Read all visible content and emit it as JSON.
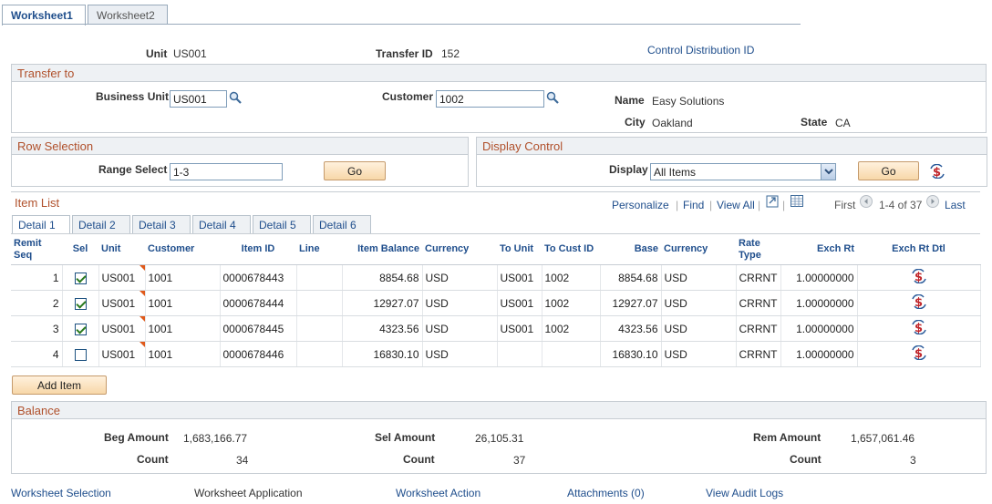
{
  "page_tabs": [
    "Worksheet1",
    "Worksheet2"
  ],
  "header": {
    "unit_label": "Unit",
    "unit_value": "US001",
    "transfer_id_label": "Transfer ID",
    "transfer_id_value": "152",
    "control_dist_link": "Control Distribution ID"
  },
  "transfer_to": {
    "title": "Transfer to",
    "business_unit_label": "Business Unit",
    "business_unit_value": "US001",
    "customer_label": "Customer",
    "customer_value": "1002",
    "name_label": "Name",
    "name_value": "Easy Solutions",
    "city_label": "City",
    "city_value": "Oakland",
    "state_label": "State",
    "state_value": "CA"
  },
  "row_selection": {
    "title": "Row Selection",
    "range_label": "Range Select",
    "range_value": "1-3",
    "go_label": "Go"
  },
  "display_control": {
    "title": "Display Control",
    "display_label": "Display",
    "display_value": "All Items",
    "go_label": "Go"
  },
  "item_list": {
    "title": "Item List",
    "personalize": "Personalize",
    "find": "Find",
    "view_all": "View All",
    "first": "First",
    "range": "1-4 of 37",
    "last": "Last",
    "tabs": [
      "Detail 1",
      "Detail 2",
      "Detail 3",
      "Detail 4",
      "Detail 5",
      "Detail 6"
    ],
    "columns": {
      "remit_seq": "Remit Seq",
      "sel": "Sel",
      "unit": "Unit",
      "customer": "Customer",
      "item_id": "Item ID",
      "line": "Line",
      "item_balance": "Item Balance",
      "currency": "Currency",
      "to_unit": "To Unit",
      "to_cust_id": "To Cust ID",
      "base": "Base",
      "base_currency": "Currency",
      "rate_type": "Rate Type",
      "exch_rt": "Exch Rt",
      "exch_rt_dtl": "Exch Rt Dtl"
    },
    "rows": [
      {
        "seq": "1",
        "sel": true,
        "unit": "US001",
        "customer": "1001",
        "item_id": "0000678443",
        "line": "",
        "balance": "8854.68",
        "currency": "USD",
        "to_unit": "US001",
        "to_cust": "1002",
        "base": "8854.68",
        "base_currency": "USD",
        "rate_type": "CRRNT",
        "exch_rt": "1.00000000"
      },
      {
        "seq": "2",
        "sel": true,
        "unit": "US001",
        "customer": "1001",
        "item_id": "0000678444",
        "line": "",
        "balance": "12927.07",
        "currency": "USD",
        "to_unit": "US001",
        "to_cust": "1002",
        "base": "12927.07",
        "base_currency": "USD",
        "rate_type": "CRRNT",
        "exch_rt": "1.00000000"
      },
      {
        "seq": "3",
        "sel": true,
        "unit": "US001",
        "customer": "1001",
        "item_id": "0000678445",
        "line": "",
        "balance": "4323.56",
        "currency": "USD",
        "to_unit": "US001",
        "to_cust": "1002",
        "base": "4323.56",
        "base_currency": "USD",
        "rate_type": "CRRNT",
        "exch_rt": "1.00000000"
      },
      {
        "seq": "4",
        "sel": false,
        "unit": "US001",
        "customer": "1001",
        "item_id": "0000678446",
        "line": "",
        "balance": "16830.10",
        "currency": "USD",
        "to_unit": "",
        "to_cust": "",
        "base": "16830.10",
        "base_currency": "USD",
        "rate_type": "CRRNT",
        "exch_rt": "1.00000000"
      }
    ],
    "add_item_label": "Add Item"
  },
  "balance": {
    "title": "Balance",
    "beg_amount_label": "Beg Amount",
    "beg_amount_value": "1,683,166.77",
    "beg_count_label": "Count",
    "beg_count_value": "34",
    "sel_amount_label": "Sel Amount",
    "sel_amount_value": "26,105.31",
    "sel_count_label": "Count",
    "sel_count_value": "37",
    "rem_amount_label": "Rem Amount",
    "rem_amount_value": "1,657,061.46",
    "rem_count_label": "Count",
    "rem_count_value": "3"
  },
  "footer_links": [
    "Worksheet Selection",
    "Worksheet Application",
    "Worksheet Action",
    "Attachments (0)",
    "View Audit Logs"
  ],
  "icons": {
    "lookup": "magnifier-icon",
    "exchange": "exchange-rate-icon",
    "grid_nav": [
      "download-icon",
      "spreadsheet-icon",
      "prev-icon",
      "next-icon"
    ]
  },
  "colors": {
    "link": "#1f4e8c",
    "group_title": "#b0502b",
    "button": "#f7d7a8"
  }
}
